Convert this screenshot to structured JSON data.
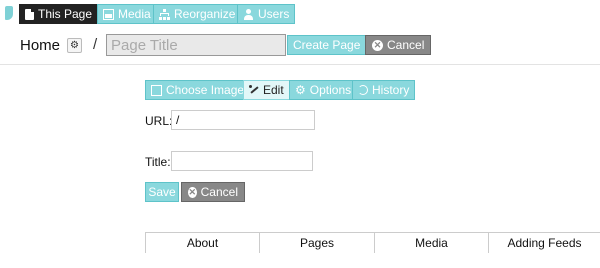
{
  "toolbar": {
    "items": [
      {
        "label": "This Page",
        "icon": "page-icon"
      },
      {
        "label": "Media",
        "icon": "media-icon"
      },
      {
        "label": "Reorganize",
        "icon": "sitemap-icon"
      },
      {
        "label": "Users",
        "icon": "user-icon"
      }
    ]
  },
  "breadcrumb": {
    "home": "Home",
    "separator": "/",
    "title_placeholder": "Page Title",
    "create_label": "Create Page",
    "cancel_label": "Cancel"
  },
  "editor": {
    "tabs": [
      {
        "label": "Choose Image",
        "icon": "image-icon"
      },
      {
        "label": "Edit",
        "icon": "wand-icon"
      },
      {
        "label": "Options",
        "icon": "gear-icon"
      },
      {
        "label": "History",
        "icon": "history-icon"
      }
    ],
    "url_label": "URL:",
    "url_value": "/",
    "title_label": "Title:",
    "title_value": "",
    "save_label": "Save",
    "cancel_label": "Cancel"
  },
  "nav": {
    "tabs": [
      "About",
      "Pages",
      "Media",
      "Adding Feeds"
    ]
  },
  "colors": {
    "accent": "#8ad8dd",
    "active": "#222222",
    "cancel": "#888888"
  }
}
